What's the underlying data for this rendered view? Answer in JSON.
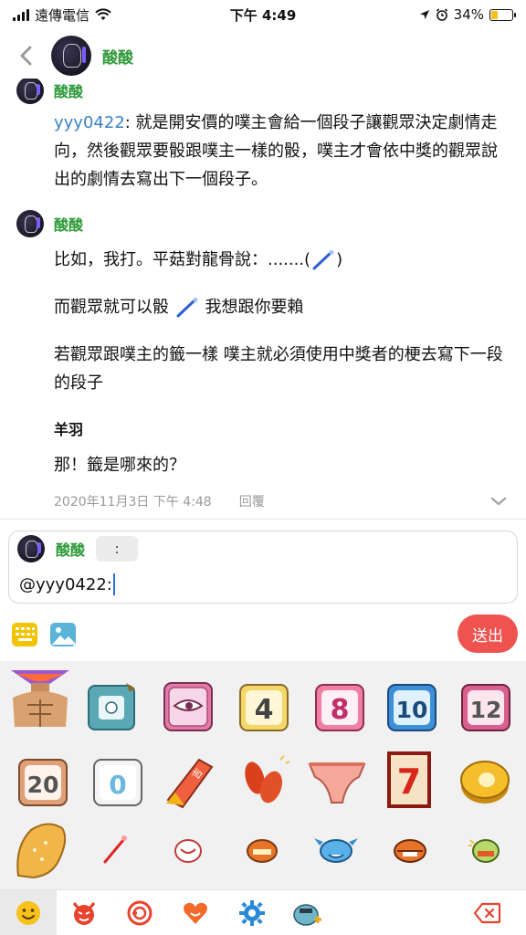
{
  "status_bar": {
    "carrier": "遠傳電信",
    "time": "下午 4:49",
    "battery": "34%",
    "battery_level": 0.34
  },
  "header": {
    "title": "酸酸"
  },
  "comments": [
    {
      "author": "酸酸",
      "mention": "yyy0422",
      "text": ": 就是開安價的噗主會給一個段子讓觀眾決定劇情走向，然後觀眾要骰跟噗主一樣的骰，噗主才會依中獎的觀眾說出的劇情去寫出下一個段子。"
    },
    {
      "author": "酸酸",
      "p1": "比如，我打。平菇對龍骨說：.......(",
      "p1_end": ")",
      "p2_a": "而觀眾就可以骰",
      "p2_b": "我想跟你要賴",
      "p3": "若觀眾跟噗主的籤一樣 噗主就必須使用中獎者的梗去寫下一段的段子",
      "p4": "羊羽",
      "p5": "那！籤是哪來的？",
      "timestamp": "2020年11月3日 下午 4:48",
      "reply_label": "回覆"
    }
  ],
  "reply_box": {
    "author": "酸酸",
    "chip": ":",
    "input_value": "@yyy0422:",
    "send_label": "送出"
  },
  "stickers": [
    "muscle-torso-sticker",
    "white-dice-sticker",
    "eye-dice-sticker",
    "dice-4-sticker",
    "dice-8-sticker",
    "dice-10-sticker",
    "dice-12-sticker",
    "dice-20-sticker",
    "dice-0-sticker",
    "ticket-stick-sticker",
    "red-beans-sticker",
    "underwear-sticker",
    "slot-seven-sticker",
    "coin-sticker",
    "bread-sticker",
    "red-wand-sticker",
    "white-blob-sticker",
    "orange-blob-sticker",
    "blue-monster-sticker",
    "orange-monster-sticker",
    "green-blob-sticker"
  ],
  "tabs": [
    "smiley-icon",
    "devil-icon",
    "no-entry-icon",
    "heart-face-icon",
    "gear-icon",
    "custom-sticker-icon",
    "backspace-icon"
  ],
  "colors": {
    "name_green": "#2e9a3a",
    "mention_blue": "#3b82c4",
    "send_red": "#ef5350",
    "panel_gray": "#f1f1f1"
  }
}
